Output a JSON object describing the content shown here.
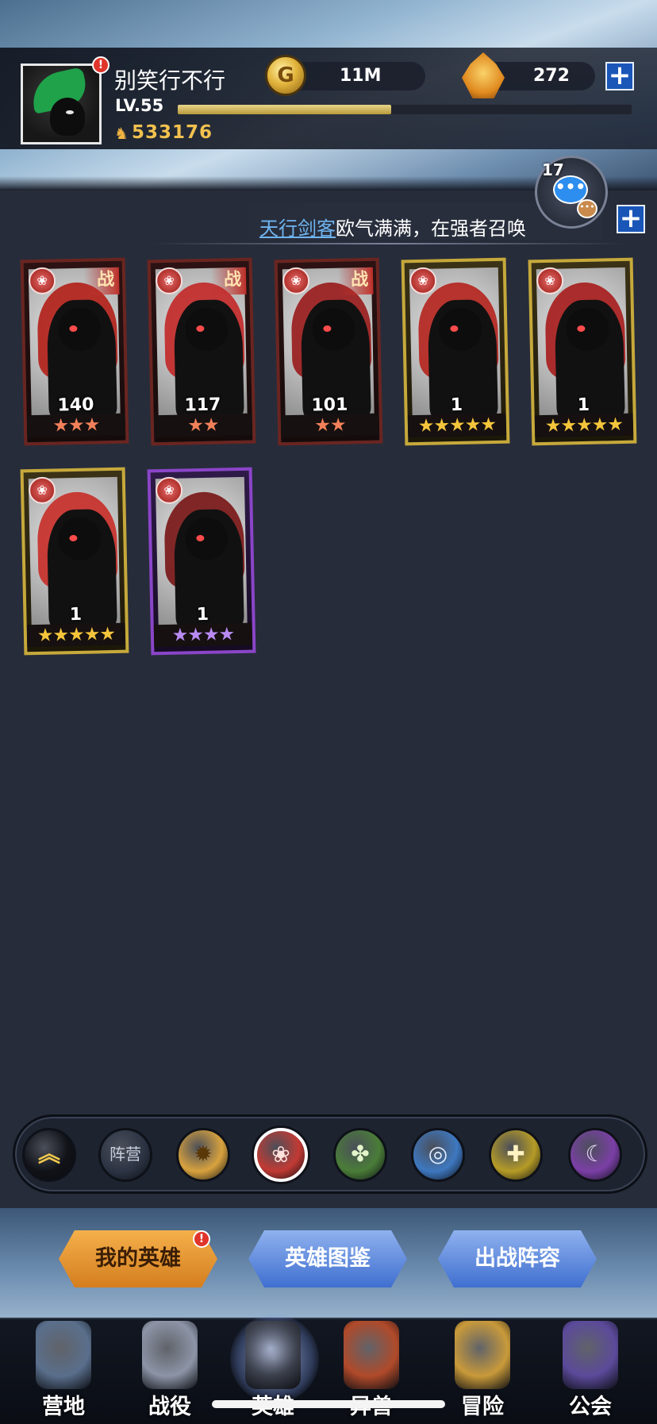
{
  "header": {
    "player_name": "别笑行不行",
    "level_label": "LV.55",
    "xp_progress": 0.47,
    "combat_power": "533176",
    "gold": "11M",
    "gems": "272"
  },
  "alerts": {
    "profile": "!",
    "my_heroes": "!"
  },
  "chat": {
    "unread_count": "17",
    "icon": "chat-icon"
  },
  "ticker": {
    "hero_name": "天行剑客",
    "message": "欧气满满，在强者召唤"
  },
  "heroes": [
    {
      "level": "140",
      "stars": "★★★",
      "rarity": "red",
      "in_battle": "战",
      "cloak_color": "#b3221b"
    },
    {
      "level": "117",
      "stars": "★★",
      "rarity": "red",
      "in_battle": "战",
      "cloak_color": "#c22a2a"
    },
    {
      "level": "101",
      "stars": "★★",
      "rarity": "red",
      "in_battle": "战",
      "cloak_color": "#9a1d1d"
    },
    {
      "level": "1",
      "stars": "★★★★★",
      "rarity": "gold",
      "in_battle": "",
      "cloak_color": "#b5261f"
    },
    {
      "level": "1",
      "stars": "★★★★★",
      "rarity": "gold",
      "in_battle": "",
      "cloak_color": "#a81e1e"
    },
    {
      "level": "1",
      "stars": "★★★★★",
      "rarity": "gold",
      "in_battle": "",
      "cloak_color": "#c8302a"
    },
    {
      "level": "1",
      "stars": "★★★★",
      "rarity": "purple",
      "in_battle": "",
      "cloak_color": "#7a1818"
    }
  ],
  "filters": [
    {
      "name": "filter-all",
      "label": "",
      "icon": "chevron-up-icon",
      "color": "#101218",
      "glyph": "︽",
      "glyph_color": "#f2c94c"
    },
    {
      "name": "filter-faction",
      "label": "阵营",
      "icon": "",
      "color": "#2c3444",
      "glyph": "",
      "glyph_color": "#c8cfdc"
    },
    {
      "name": "filter-light",
      "label": "",
      "icon": "sun-icon",
      "color": "#d8a23e",
      "glyph": "✹",
      "glyph_color": "#5a3808"
    },
    {
      "name": "filter-fire",
      "label": "",
      "icon": "flame-icon",
      "color": "#c23a34",
      "glyph": "❀",
      "glyph_color": "#ffe1dc"
    },
    {
      "name": "filter-nature",
      "label": "",
      "icon": "leaf-icon",
      "color": "#4a7d38",
      "glyph": "✤",
      "glyph_color": "#e3f5c9"
    },
    {
      "name": "filter-water",
      "label": "",
      "icon": "wave-icon",
      "color": "#3e78c0",
      "glyph": "◎",
      "glyph_color": "#e0eeff"
    },
    {
      "name": "filter-holy",
      "label": "",
      "icon": "cross-icon",
      "color": "#b59b26",
      "glyph": "✚",
      "glyph_color": "#fff3c2"
    },
    {
      "name": "filter-dark",
      "label": "",
      "icon": "moon-icon",
      "color": "#7b3fa6",
      "glyph": "☾",
      "glyph_color": "#f0dcff"
    }
  ],
  "tabs": {
    "my_heroes": "我的英雄",
    "hero_codex": "英雄图鉴",
    "battle_lineup": "出战阵容"
  },
  "nav": [
    {
      "label": "营地",
      "icon": "castle-icon",
      "color": "#5a6f8c"
    },
    {
      "label": "战役",
      "icon": "crossed-swords-icon",
      "color": "#8c94a6"
    },
    {
      "label": "英雄",
      "icon": "helmet-icon",
      "color": "#3a3e4a"
    },
    {
      "label": "异兽",
      "icon": "beast-icon",
      "color": "#b04a2a"
    },
    {
      "label": "冒险",
      "icon": "compass-icon",
      "color": "#c99a3a"
    },
    {
      "label": "公会",
      "icon": "guild-banner-icon",
      "color": "#5b4a9a"
    }
  ]
}
